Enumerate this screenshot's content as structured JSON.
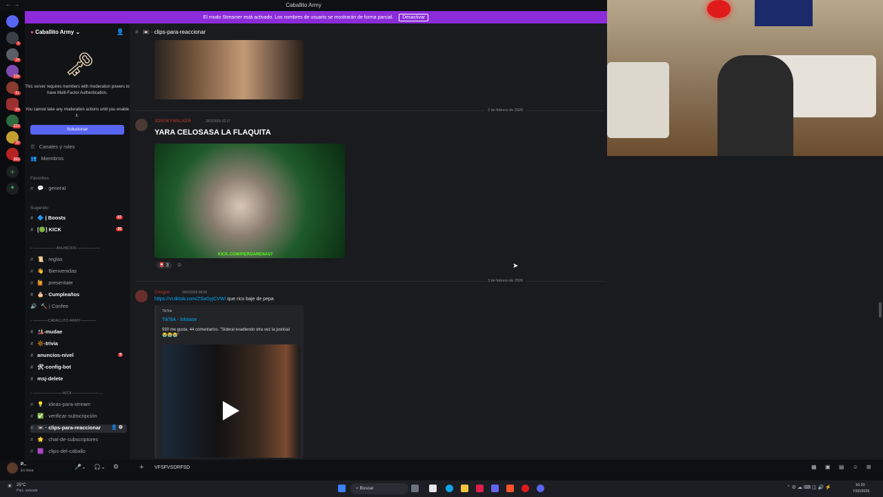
{
  "window": {
    "title": "Caballito Army"
  },
  "banner": {
    "text": "El modo Streamer está activado. Los nombres de usuario se mostrarán de forma parcial.",
    "button": "Desactivar"
  },
  "server": {
    "name": "Caballito Army",
    "mfa_text_1": "This server requires members with moderation powers to have Multi-Factor Authentication.",
    "mfa_text_2": "You cannot take any moderation actions until you enable it.",
    "solve_button": "Solucionar",
    "links": [
      {
        "label": "Canales y roles"
      },
      {
        "label": "Miembros"
      }
    ],
    "favorites_label": "Favoritos",
    "suggested_label": "Sugerido",
    "categories": {
      "anuncios": "ANUNCIOS",
      "caballito": "CABALLITO ARMY",
      "kick": "KICK"
    },
    "channels": [
      {
        "name": "general",
        "bold": false
      },
      {
        "name": "Boosts",
        "bold": true,
        "count": "57"
      },
      {
        "name": "KICK",
        "bold": true,
        "count": "26"
      },
      {
        "name": "reglas",
        "bold": false
      },
      {
        "name": "Bienvenidas",
        "bold": false
      },
      {
        "name": "presentate",
        "bold": false
      },
      {
        "name": "Cumpleaños",
        "bold": true
      },
      {
        "name": "Confee",
        "bold": false
      },
      {
        "name": "-mudae",
        "bold": true
      },
      {
        "name": "-trivia",
        "bold": true
      },
      {
        "name": "anuncios-nivel",
        "bold": true,
        "count": "9"
      },
      {
        "name": "-config-bot",
        "bold": true
      },
      {
        "name": "msj-delete",
        "bold": true
      },
      {
        "name": "ideas-para-stream",
        "bold": false
      },
      {
        "name": "verificar-subscripción",
        "bold": false
      },
      {
        "name": "clips-para-reaccionar",
        "bold": true
      },
      {
        "name": "chat-de-subscriptores",
        "bold": false
      },
      {
        "name": "clips-del-caballo",
        "bold": false
      }
    ],
    "server_badges": [
      "2",
      "14",
      "236",
      "61",
      "94",
      "223",
      "10",
      "263"
    ]
  },
  "user": {
    "name": "P...",
    "status": "En línea"
  },
  "channel": {
    "name": "clips-para-reaccionar"
  },
  "messages": {
    "date1": "2 de febrero de 2026",
    "msg1": {
      "author": "JONSKYWALKER",
      "time": "2/02/2026 02:17",
      "text": "YARA CELOSASA LA FLAQUITA",
      "watermark": "KICK.COM/PIEROARENAS7",
      "reaction_count": "3"
    },
    "date2": "3 de febrero de 2026",
    "msg2": {
      "author": "Crisgon",
      "time": "3/02/2026 08:09",
      "link": "https://vt.tiktok.com/ZSaGyjCVW/",
      "text": "que rico baje de pepa",
      "embed": {
        "provider": "TikTok",
        "title": "TikTok - lolotase",
        "desc": "930 me gusta, 44 comentarios. \"Sideral evadiendo otra vez la justicia! 😭😭😭\""
      }
    }
  },
  "input": {
    "value": "VFSFVSDRFSD"
  },
  "taskbar": {
    "weather": "25°C",
    "weather_desc": "Parc. soleado",
    "search": "Buscar",
    "time": "16:20",
    "date": "7/02/2026"
  }
}
